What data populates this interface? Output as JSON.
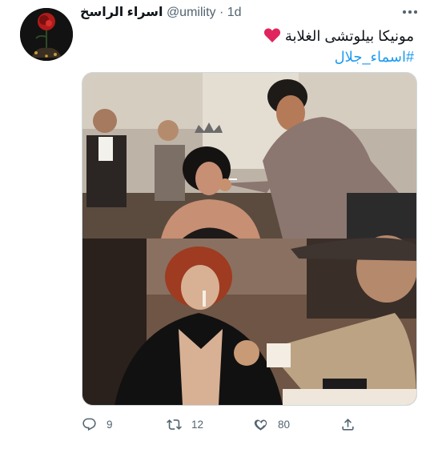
{
  "tweet": {
    "display_name": "اسراء الراسخ",
    "handle": "@umility",
    "separator": "·",
    "time": "1d",
    "text": "مونيكا بيلوتشى الغلابة",
    "hashtag": "#اسماء_جلال"
  },
  "actions": {
    "reply_count": "9",
    "retweet_count": "12",
    "like_count": "80"
  },
  "icons": {
    "avatar": "rose-avatar",
    "more": "more-icon",
    "heart_emoji": "red-heart-emoji",
    "reply": "reply-icon",
    "retweet": "retweet-icon",
    "like": "like-icon",
    "share": "share-icon"
  },
  "colors": {
    "link": "#1d9bf0",
    "secondary_text": "#536471",
    "heart_emoji": "#e0245e"
  }
}
